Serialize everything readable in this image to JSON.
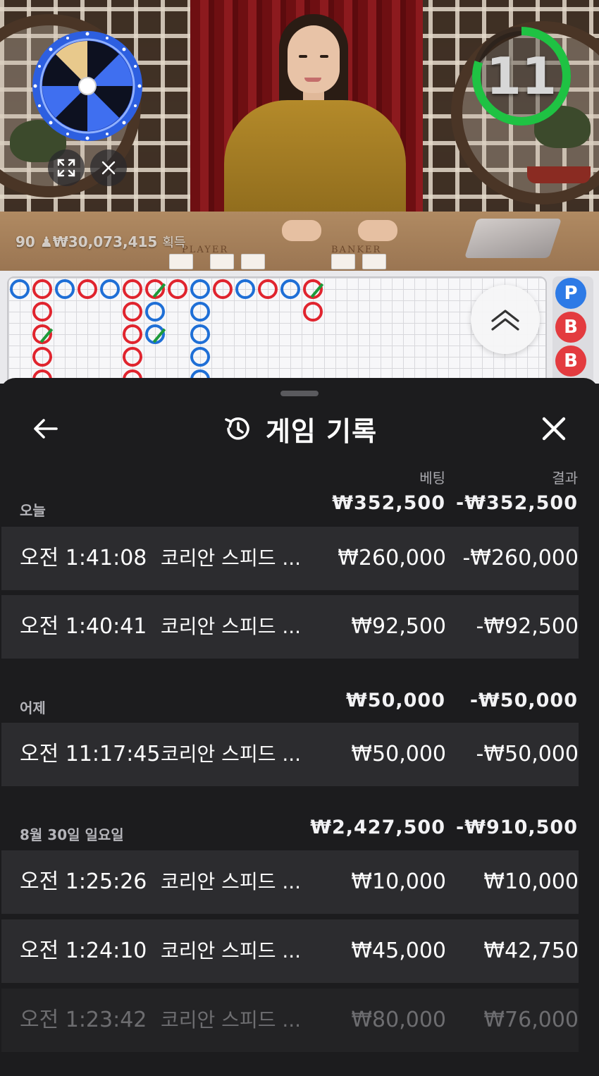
{
  "video": {
    "timer": "11",
    "winnings": {
      "players": "90",
      "amount": "₩30,073,415",
      "suffix": "획득"
    },
    "table_labels": {
      "player": "PLAYER",
      "banker": "BANKER"
    }
  },
  "roadmap": {
    "side_predictions": [
      "P",
      "B",
      "B"
    ]
  },
  "history": {
    "title": "게임 기록",
    "columns": {
      "bet": "베팅",
      "result": "결과"
    },
    "groups": [
      {
        "label": "오늘",
        "bet_total": "₩352,500",
        "result_total": "-₩352,500",
        "rows": [
          {
            "time": "오전 1:41:08",
            "game": "코리안 스피드 ...",
            "bet": "₩260,000",
            "result": "-₩260,000"
          },
          {
            "time": "오전 1:40:41",
            "game": "코리안 스피드 ...",
            "bet": "₩92,500",
            "result": "-₩92,500"
          }
        ]
      },
      {
        "label": "어제",
        "bet_total": "₩50,000",
        "result_total": "-₩50,000",
        "rows": [
          {
            "time": "오전 11:17:45",
            "game": "코리안 스피드 ...",
            "bet": "₩50,000",
            "result": "-₩50,000"
          }
        ]
      },
      {
        "label": "8월 30일 일요일",
        "bet_total": "₩2,427,500",
        "result_total": "-₩910,500",
        "rows": [
          {
            "time": "오전 1:25:26",
            "game": "코리안 스피드 ...",
            "bet": "₩10,000",
            "result": "₩10,000"
          },
          {
            "time": "오전 1:24:10",
            "game": "코리안 스피드 ...",
            "bet": "₩45,000",
            "result": "₩42,750"
          },
          {
            "time": "오전 1:23:42",
            "game": "코리안 스피드 ...",
            "bet": "₩80,000",
            "result": "₩76,000"
          }
        ]
      }
    ]
  },
  "colors": {
    "sheet_bg": "#1c1c1e",
    "row_bg": "#2c2c2f",
    "timer_ring": "#1fc243",
    "wheel_blue": "#2d5fe0",
    "player_blue": "#1f6fd6",
    "banker_red": "#e0242e",
    "tie_green": "#1d9a3a"
  },
  "icons": [
    "wheel-icon",
    "fullscreen-icon",
    "close-icon",
    "chevron-double-up-icon",
    "back-arrow-icon",
    "history-icon",
    "close-x-icon"
  ]
}
